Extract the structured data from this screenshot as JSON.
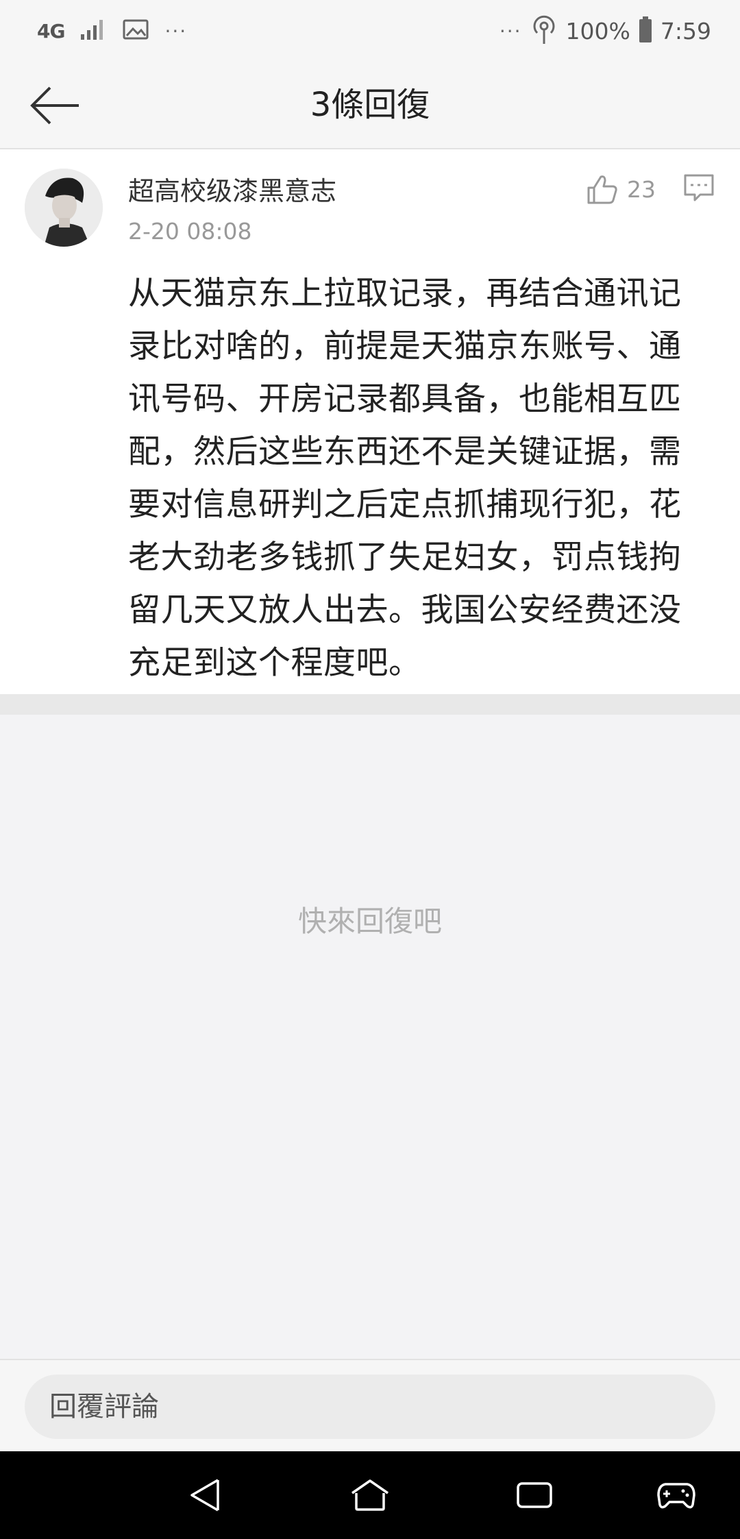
{
  "status_bar": {
    "network_type": "4G",
    "more_indicator": "···",
    "battery_percent": "100%",
    "time": "7:59",
    "icons": [
      "network-4g-icon",
      "signal-icon",
      "image-notification-icon",
      "hotspot-icon",
      "battery-icon"
    ]
  },
  "header": {
    "title": "3條回復",
    "back_icon": "back-arrow-icon"
  },
  "comment": {
    "author": "超高校级漆黑意志",
    "timestamp": "2-20 08:08",
    "likes": "23",
    "body": "从天猫京东上拉取记录，再结合通讯记录比对啥的，前提是天猫京东账号、通讯号码、开房记录都具备，也能相互匹配，然后这些东西还不是关键证据，需要对信息研判之后定点抓捕现行犯，花老大劲老多钱抓了失足妇女，罚点钱拘留几天又放人出去。我国公安经费还没充足到这个程度吧。",
    "like_icon": "thumbs-up-icon",
    "reply_icon": "comment-icon"
  },
  "empty_state": {
    "hint": "快來回復吧"
  },
  "reply_bar": {
    "placeholder": "回覆評論"
  },
  "nav_bar": {
    "icons": [
      "back-triangle-icon",
      "home-icon",
      "recents-icon",
      "game-controller-icon"
    ]
  },
  "colors": {
    "page_background": "#f3f3f5",
    "card_background": "#ffffff",
    "muted_text": "#999999",
    "nav_background": "#000000"
  }
}
